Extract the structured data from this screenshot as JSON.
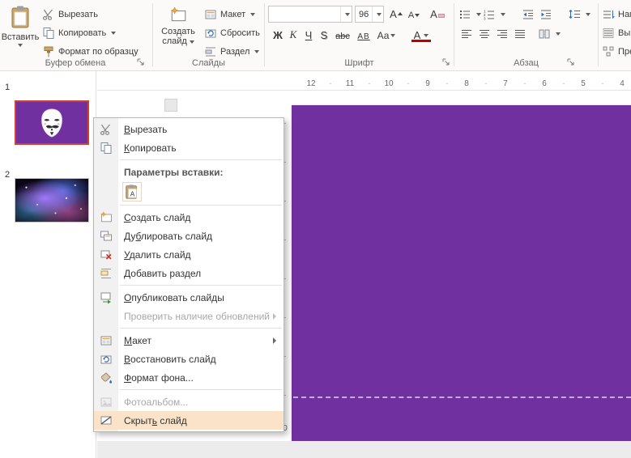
{
  "colors": {
    "slide_purple": "#7030A0",
    "selected_slide_border": "#D0402E",
    "menu_highlight": "#FBE3C9"
  },
  "ribbon": {
    "clipboard_group": {
      "label": "Буфер обмена",
      "paste": "Вставить",
      "cut": "Вырезать",
      "copy": "Копировать",
      "format_painter": "Формат по образцу"
    },
    "slides_group": {
      "label": "Слайды",
      "new_slide_line1": "Создать",
      "new_slide_line2": "слайд",
      "layout": "Макет",
      "reset": "Сбросить",
      "section": "Раздел"
    },
    "font_group": {
      "label": "Шрифт",
      "font_name": "",
      "font_size": "96",
      "grow_font": "А",
      "shrink_font": "А",
      "clear_format": "А",
      "bold": "Ж",
      "italic": "К",
      "underline": "Ч",
      "text_shadow": "S",
      "strikethrough": "abc",
      "char_spacing": "АВ",
      "change_case": "Аа",
      "font_color": "А"
    },
    "paragraph_group": {
      "label": "Абзац"
    },
    "right_group": {
      "items": [
        "Напр",
        "Выро",
        "Прео"
      ]
    }
  },
  "slide_panel": {
    "slides": [
      {
        "number": "1",
        "selected": true,
        "content": "anonymous-mask-on-purple"
      },
      {
        "number": "2",
        "selected": false,
        "content": "space-nebula-photo"
      }
    ]
  },
  "context_menu": {
    "items": [
      {
        "id": "cut",
        "icon": "scissors",
        "label": "Вырезать",
        "accel": 0
      },
      {
        "id": "copy",
        "icon": "copy",
        "label": "Копировать",
        "accel": 0
      },
      {
        "type": "separator"
      },
      {
        "type": "caption",
        "label": "Параметры вставки:"
      },
      {
        "type": "paste-options",
        "buttons": [
          {
            "icon": "paste-keep",
            "name": "paste-option-keep-source-formatting"
          }
        ]
      },
      {
        "type": "separator"
      },
      {
        "id": "new-slide",
        "icon": "new-slide",
        "label": "Создать слайд",
        "accel": 0
      },
      {
        "id": "duplicate-slide",
        "icon": "duplicate-slide",
        "label": "Дублировать слайд",
        "accel": 2
      },
      {
        "id": "delete-slide",
        "icon": "delete-slide",
        "label": "Удалить слайд",
        "accel": 0
      },
      {
        "id": "add-section",
        "icon": "add-section",
        "label": "Добавить раздел",
        "accel": 0
      },
      {
        "type": "separator"
      },
      {
        "id": "publish-slides",
        "icon": "publish-slides",
        "label": "Опубликовать слайды",
        "accel": 0
      },
      {
        "id": "check-updates",
        "icon": null,
        "label": "Проверить наличие обновлений",
        "disabled": true,
        "submenu": true
      },
      {
        "type": "separator"
      },
      {
        "id": "layout",
        "icon": "layout",
        "label": "Макет",
        "accel": 0,
        "submenu": true
      },
      {
        "id": "reset-slide",
        "icon": "reset",
        "label": "Восстановить слайд",
        "accel": 0
      },
      {
        "id": "format-background",
        "icon": "format-background",
        "label": "Формат фона...",
        "accel": 0
      },
      {
        "type": "separator"
      },
      {
        "id": "photo-album",
        "icon": "photo-album",
        "label": "Фотоальбом...",
        "disabled": true
      },
      {
        "id": "hide-slide",
        "icon": "hide-slide",
        "label": "Скрыть слайд",
        "accel": 5,
        "highlighted": true
      }
    ]
  },
  "rulers": {
    "horizontal": [
      "12",
      "11",
      "10",
      "9",
      "8",
      "7",
      "6",
      "5",
      "4"
    ],
    "vertical_zero": "0"
  }
}
